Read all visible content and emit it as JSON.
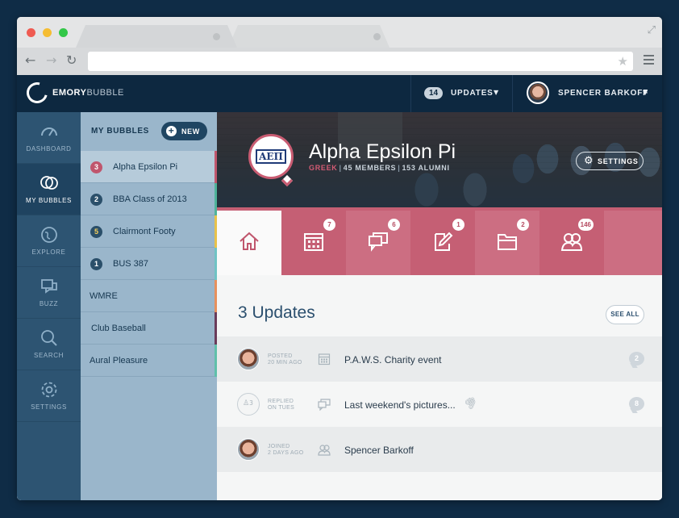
{
  "app": {
    "brand_bold": "EMORY",
    "brand_light": "BUBBLE"
  },
  "topbar": {
    "updates_count": "14",
    "updates_label": "UPDATES",
    "user_name": "SPENCER BARKOFF",
    "caret": "▼"
  },
  "leftnav": [
    {
      "label": "DASHBOARD",
      "icon": "gauge-icon",
      "active": false
    },
    {
      "label": "MY BUBBLES",
      "icon": "chat-bubbles-icon",
      "active": true
    },
    {
      "label": "EXPLORE",
      "icon": "globe-icon",
      "active": false
    },
    {
      "label": "BUZZ",
      "icon": "buzz-icon",
      "active": false
    },
    {
      "label": "SEARCH",
      "icon": "search-icon",
      "active": false
    },
    {
      "label": "SETTINGS",
      "icon": "gear-icon",
      "active": false
    }
  ],
  "bubbles": {
    "title": "MY BUBBLES",
    "new_label": "NEW",
    "items": [
      {
        "badge": "3",
        "name": "Alpha Epsilon Pi",
        "accent": "#c0566d",
        "badge_color": "#c0566d",
        "active": true
      },
      {
        "badge": "2",
        "name": "BBA Class of 2013",
        "accent": "#4fb39a",
        "badge_color": "#2a4f6a",
        "active": false
      },
      {
        "badge": "5",
        "name": "Clairmont Footy",
        "accent": "#e8c24a",
        "badge_color": "#2a4f6a",
        "active": false
      },
      {
        "badge": "1",
        "name": "BUS 387",
        "accent": "#6fc3c4",
        "badge_color": "#2a4f6a",
        "active": false
      },
      {
        "badge": "",
        "name": "WMRE",
        "accent": "#e7905d",
        "badge_color": "",
        "active": false
      },
      {
        "badge": "",
        "name": "Club Baseball",
        "accent": "#6a3b5a",
        "badge_color": "",
        "active": false
      },
      {
        "badge": "",
        "name": "Aural Pleasure",
        "accent": "#5fc0aa",
        "badge_color": "",
        "active": false
      }
    ]
  },
  "group": {
    "logo_letters": "ΑΕΠ",
    "name": "Alpha Epsilon Pi",
    "category": "GREEK",
    "members": "45 MEMBERS",
    "alumni": "153 ALUMNI",
    "settings_label": "SETTINGS",
    "accent": "#cc6e82"
  },
  "tiles": [
    {
      "icon": "home-icon",
      "count": ""
    },
    {
      "icon": "calendar-icon",
      "count": "7"
    },
    {
      "icon": "chat-icon",
      "count": "6"
    },
    {
      "icon": "edit-note-icon",
      "count": "1"
    },
    {
      "icon": "folder-icon",
      "count": "2"
    },
    {
      "icon": "members-icon",
      "count": "146"
    }
  ],
  "updates": {
    "title": "3 Updates",
    "see_all": "SEE ALL",
    "rows": [
      {
        "action": "POSTED",
        "when": "20 MIN AGO",
        "type_icon": "calendar-icon",
        "title": "P.A.W.S. Charity event",
        "comments": "2",
        "attachment": false,
        "avatar": "photo"
      },
      {
        "action": "REPLIED",
        "when": "ON TUES",
        "type_icon": "chat-icon",
        "title": "Last weekend's pictures...",
        "comments": "8",
        "attachment": true,
        "avatar": "group",
        "avatar_count": "3"
      },
      {
        "action": "JOINED",
        "when": "2 DAYS AGO",
        "type_icon": "members-icon",
        "title": "Spencer Barkoff",
        "comments": "",
        "attachment": false,
        "avatar": "photo"
      }
    ]
  }
}
